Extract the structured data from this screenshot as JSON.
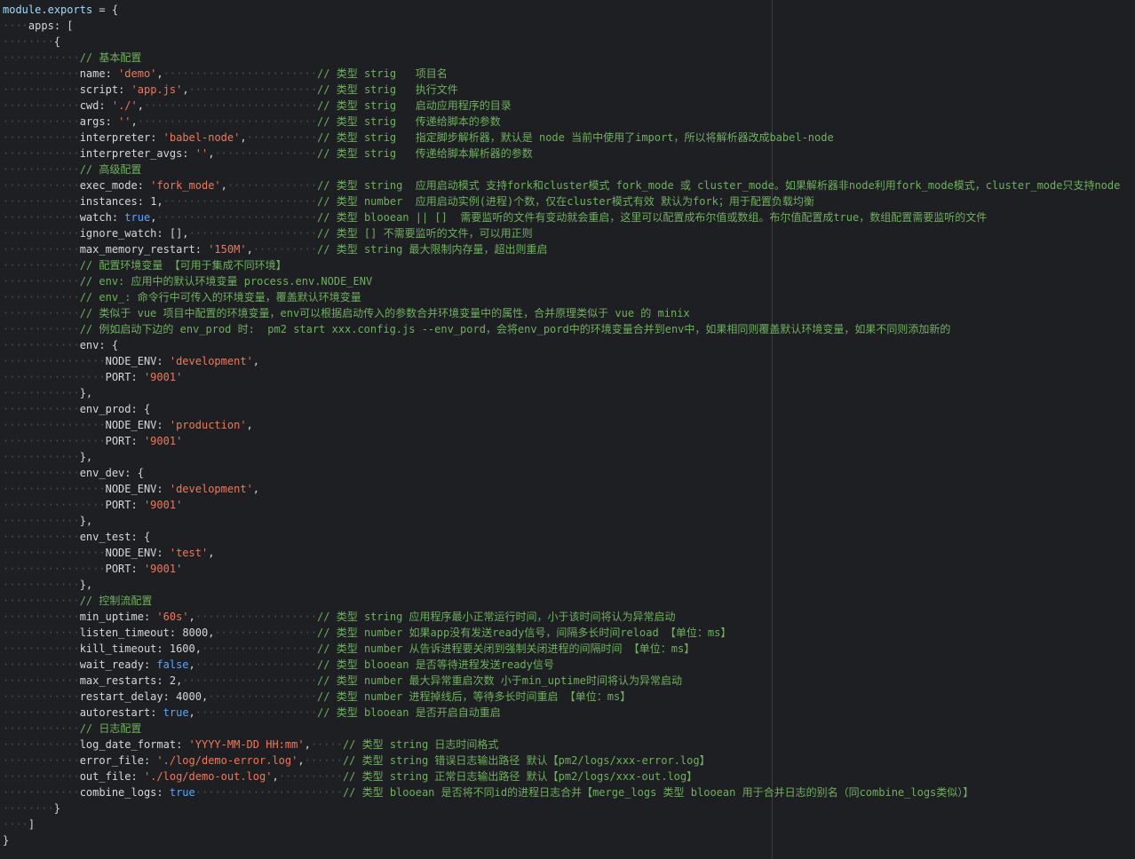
{
  "editor": {
    "language": "javascript",
    "colors": {
      "background": "#1e1f22",
      "key": "#d7d7d7",
      "string": "#f07858",
      "boolean": "#57a7ff",
      "comment": "#6fb05e",
      "whitespace_marker": "#4b4d52"
    },
    "lines": [
      {
        "indent": 0,
        "tokens": [
          {
            "t": "v",
            "x": "module"
          },
          {
            "t": "p",
            "x": "."
          },
          {
            "t": "v",
            "x": "exports"
          },
          {
            "t": "p",
            "x": " = {"
          }
        ]
      },
      {
        "indent": 1,
        "tokens": [
          {
            "t": "k",
            "x": "apps"
          },
          {
            "t": "p",
            "x": ": ["
          }
        ]
      },
      {
        "indent": 2,
        "tokens": [
          {
            "t": "p",
            "x": "{"
          }
        ]
      },
      {
        "indent": 3,
        "tokens": [
          {
            "t": "c",
            "x": "// 基本配置"
          }
        ]
      },
      {
        "indent": 3,
        "tokens": [
          {
            "t": "k",
            "x": "name"
          },
          {
            "t": "p",
            "x": ": "
          },
          {
            "t": "s",
            "x": "'demo'"
          },
          {
            "t": "p",
            "x": ","
          }
        ],
        "pad": 37,
        "comment": "// 类型 strig   项目名"
      },
      {
        "indent": 3,
        "tokens": [
          {
            "t": "k",
            "x": "script"
          },
          {
            "t": "p",
            "x": ": "
          },
          {
            "t": "s",
            "x": "'app.js'"
          },
          {
            "t": "p",
            "x": ","
          }
        ],
        "pad": 37,
        "comment": "// 类型 strig   执行文件"
      },
      {
        "indent": 3,
        "tokens": [
          {
            "t": "k",
            "x": "cwd"
          },
          {
            "t": "p",
            "x": ": "
          },
          {
            "t": "s",
            "x": "'./'"
          },
          {
            "t": "p",
            "x": ","
          }
        ],
        "pad": 37,
        "comment": "// 类型 strig   启动应用程序的目录"
      },
      {
        "indent": 3,
        "tokens": [
          {
            "t": "k",
            "x": "args"
          },
          {
            "t": "p",
            "x": ": "
          },
          {
            "t": "s",
            "x": "''"
          },
          {
            "t": "p",
            "x": ","
          }
        ],
        "pad": 37,
        "comment": "// 类型 strig   传递给脚本的参数"
      },
      {
        "indent": 3,
        "tokens": [
          {
            "t": "k",
            "x": "interpreter"
          },
          {
            "t": "p",
            "x": ": "
          },
          {
            "t": "s",
            "x": "'babel-node'"
          },
          {
            "t": "p",
            "x": ","
          }
        ],
        "pad": 37,
        "comment": "// 类型 strig   指定脚步解析器，默认是 node 当前中使用了import，所以将解析器改成babel-node"
      },
      {
        "indent": 3,
        "tokens": [
          {
            "t": "k",
            "x": "interpreter_avgs"
          },
          {
            "t": "p",
            "x": ": "
          },
          {
            "t": "s",
            "x": "''"
          },
          {
            "t": "p",
            "x": ","
          }
        ],
        "pad": 37,
        "comment": "// 类型 strig   传递给脚本解析器的参数"
      },
      {
        "indent": 3,
        "tokens": [
          {
            "t": "c",
            "x": "// 高级配置"
          }
        ]
      },
      {
        "indent": 3,
        "tokens": [
          {
            "t": "k",
            "x": "exec_mode"
          },
          {
            "t": "p",
            "x": ": "
          },
          {
            "t": "s",
            "x": "'fork_mode'"
          },
          {
            "t": "p",
            "x": ","
          }
        ],
        "pad": 37,
        "comment": "// 类型 string  应用启动模式 支持fork和cluster模式 fork_mode 或 cluster_mode。如果解析器非node利用fork_mode模式，cluster_mode只支持node"
      },
      {
        "indent": 3,
        "tokens": [
          {
            "t": "k",
            "x": "instances"
          },
          {
            "t": "p",
            "x": ": "
          },
          {
            "t": "n",
            "x": "1"
          },
          {
            "t": "p",
            "x": ","
          }
        ],
        "pad": 37,
        "comment": "// 类型 number  应用启动实例(进程)个数，仅在cluster模式有效 默认为fork；用于配置负载均衡"
      },
      {
        "indent": 3,
        "tokens": [
          {
            "t": "k",
            "x": "watch"
          },
          {
            "t": "p",
            "x": ": "
          },
          {
            "t": "b",
            "x": "true"
          },
          {
            "t": "p",
            "x": ","
          }
        ],
        "pad": 37,
        "comment": "// 类型 blooean || []  需要监听的文件有变动就会重启，这里可以配置成布尔值或数组。布尔值配置成true，数组配置需要监听的文件"
      },
      {
        "indent": 3,
        "tokens": [
          {
            "t": "k",
            "x": "ignore_watch"
          },
          {
            "t": "p",
            "x": ": [],"
          }
        ],
        "pad": 37,
        "comment": "// 类型 [] 不需要监听的文件，可以用正则"
      },
      {
        "indent": 3,
        "tokens": [
          {
            "t": "k",
            "x": "max_memory_restart"
          },
          {
            "t": "p",
            "x": ": "
          },
          {
            "t": "s",
            "x": "'150M'"
          },
          {
            "t": "p",
            "x": ","
          }
        ],
        "pad": 37,
        "comment": "// 类型 string 最大限制内存量，超出则重启"
      },
      {
        "indent": 3,
        "tokens": [
          {
            "t": "c",
            "x": "// 配置环境变量 【可用于集成不同环境】"
          }
        ]
      },
      {
        "indent": 3,
        "tokens": [
          {
            "t": "c",
            "x": "// env: 应用中的默认环境变量 process.env.NODE_ENV"
          }
        ]
      },
      {
        "indent": 3,
        "tokens": [
          {
            "t": "c",
            "x": "// env_: 命令行中可传入的环境变量，覆盖默认环境变量"
          }
        ]
      },
      {
        "indent": 3,
        "tokens": [
          {
            "t": "c",
            "x": "// 类似于 vue 项目中配置的环境变量，env可以根据启动传入的参数合并环境变量中的属性，合并原理类似于 vue 的 minix"
          }
        ]
      },
      {
        "indent": 3,
        "tokens": [
          {
            "t": "c",
            "x": "// 例如启动下边的 env_prod 时:  pm2 start xxx.config.js --env_pord，会将env_pord中的环境变量合并到env中，如果相同则覆盖默认环境变量，如果不同则添加新的"
          }
        ]
      },
      {
        "indent": 3,
        "tokens": [
          {
            "t": "k",
            "x": "env"
          },
          {
            "t": "p",
            "x": ": {"
          }
        ]
      },
      {
        "indent": 4,
        "tokens": [
          {
            "t": "k",
            "x": "NODE_ENV"
          },
          {
            "t": "p",
            "x": ": "
          },
          {
            "t": "s",
            "x": "'development'"
          },
          {
            "t": "p",
            "x": ","
          }
        ]
      },
      {
        "indent": 4,
        "tokens": [
          {
            "t": "k",
            "x": "PORT"
          },
          {
            "t": "p",
            "x": ": "
          },
          {
            "t": "s",
            "x": "'9001'"
          }
        ]
      },
      {
        "indent": 3,
        "tokens": [
          {
            "t": "p",
            "x": "},"
          }
        ]
      },
      {
        "indent": 3,
        "tokens": [
          {
            "t": "k",
            "x": "env_prod"
          },
          {
            "t": "p",
            "x": ": {"
          }
        ]
      },
      {
        "indent": 4,
        "tokens": [
          {
            "t": "k",
            "x": "NODE_ENV"
          },
          {
            "t": "p",
            "x": ": "
          },
          {
            "t": "s",
            "x": "'production'"
          },
          {
            "t": "p",
            "x": ","
          }
        ]
      },
      {
        "indent": 4,
        "tokens": [
          {
            "t": "k",
            "x": "PORT"
          },
          {
            "t": "p",
            "x": ": "
          },
          {
            "t": "s",
            "x": "'9001'"
          }
        ]
      },
      {
        "indent": 3,
        "tokens": [
          {
            "t": "p",
            "x": "},"
          }
        ]
      },
      {
        "indent": 3,
        "tokens": [
          {
            "t": "k",
            "x": "env_dev"
          },
          {
            "t": "p",
            "x": ": {"
          }
        ]
      },
      {
        "indent": 4,
        "tokens": [
          {
            "t": "k",
            "x": "NODE_ENV"
          },
          {
            "t": "p",
            "x": ": "
          },
          {
            "t": "s",
            "x": "'development'"
          },
          {
            "t": "p",
            "x": ","
          }
        ]
      },
      {
        "indent": 4,
        "tokens": [
          {
            "t": "k",
            "x": "PORT"
          },
          {
            "t": "p",
            "x": ": "
          },
          {
            "t": "s",
            "x": "'9001'"
          }
        ]
      },
      {
        "indent": 3,
        "tokens": [
          {
            "t": "p",
            "x": "},"
          }
        ]
      },
      {
        "indent": 3,
        "tokens": [
          {
            "t": "k",
            "x": "env_test"
          },
          {
            "t": "p",
            "x": ": {"
          }
        ]
      },
      {
        "indent": 4,
        "tokens": [
          {
            "t": "k",
            "x": "NODE_ENV"
          },
          {
            "t": "p",
            "x": ": "
          },
          {
            "t": "s",
            "x": "'test'"
          },
          {
            "t": "p",
            "x": ","
          }
        ]
      },
      {
        "indent": 4,
        "tokens": [
          {
            "t": "k",
            "x": "PORT"
          },
          {
            "t": "p",
            "x": ": "
          },
          {
            "t": "s",
            "x": "'9001'"
          }
        ]
      },
      {
        "indent": 3,
        "tokens": [
          {
            "t": "p",
            "x": "},"
          }
        ]
      },
      {
        "indent": 3,
        "tokens": [
          {
            "t": "c",
            "x": "// 控制流配置"
          }
        ]
      },
      {
        "indent": 3,
        "tokens": [
          {
            "t": "k",
            "x": "min_uptime"
          },
          {
            "t": "p",
            "x": ": "
          },
          {
            "t": "s",
            "x": "'60s'"
          },
          {
            "t": "p",
            "x": ","
          }
        ],
        "pad": 37,
        "comment": "// 类型 string 应用程序最小正常运行时间，小于该时间将认为异常启动"
      },
      {
        "indent": 3,
        "tokens": [
          {
            "t": "k",
            "x": "listen_timeout"
          },
          {
            "t": "p",
            "x": ": "
          },
          {
            "t": "n",
            "x": "8000"
          },
          {
            "t": "p",
            "x": ","
          }
        ],
        "pad": 37,
        "comment": "// 类型 number 如果app没有发送ready信号，间隔多长时间reload 【单位：ms】"
      },
      {
        "indent": 3,
        "tokens": [
          {
            "t": "k",
            "x": "kill_timeout"
          },
          {
            "t": "p",
            "x": ": "
          },
          {
            "t": "n",
            "x": "1600"
          },
          {
            "t": "p",
            "x": ","
          }
        ],
        "pad": 37,
        "comment": "// 类型 number 从告诉进程要关闭到强制关闭进程的间隔时间 【单位：ms】"
      },
      {
        "indent": 3,
        "tokens": [
          {
            "t": "k",
            "x": "wait_ready"
          },
          {
            "t": "p",
            "x": ": "
          },
          {
            "t": "b",
            "x": "false"
          },
          {
            "t": "p",
            "x": ","
          }
        ],
        "pad": 37,
        "comment": "// 类型 blooean 是否等待进程发送ready信号"
      },
      {
        "indent": 3,
        "tokens": [
          {
            "t": "k",
            "x": "max_restarts"
          },
          {
            "t": "p",
            "x": ": "
          },
          {
            "t": "n",
            "x": "2"
          },
          {
            "t": "p",
            "x": ","
          }
        ],
        "pad": 37,
        "comment": "// 类型 number 最大异常重启次数 小于min_uptime时间将认为异常启动"
      },
      {
        "indent": 3,
        "tokens": [
          {
            "t": "k",
            "x": "restart_delay"
          },
          {
            "t": "p",
            "x": ": "
          },
          {
            "t": "n",
            "x": "4000"
          },
          {
            "t": "p",
            "x": ","
          }
        ],
        "pad": 37,
        "comment": "// 类型 number 进程掉线后，等待多长时间重启 【单位：ms】"
      },
      {
        "indent": 3,
        "tokens": [
          {
            "t": "k",
            "x": "autorestart"
          },
          {
            "t": "p",
            "x": ": "
          },
          {
            "t": "b",
            "x": "true"
          },
          {
            "t": "p",
            "x": ","
          }
        ],
        "pad": 37,
        "comment": "// 类型 blooean 是否开启自动重启"
      },
      {
        "indent": 3,
        "tokens": [
          {
            "t": "c",
            "x": "// 日志配置"
          }
        ]
      },
      {
        "indent": 3,
        "tokens": [
          {
            "t": "k",
            "x": "log_date_format"
          },
          {
            "t": "p",
            "x": ": "
          },
          {
            "t": "s",
            "x": "'YYYY-MM-DD HH:mm'"
          },
          {
            "t": "p",
            "x": ","
          }
        ],
        "pad": 41,
        "comment": "// 类型 string 日志时间格式"
      },
      {
        "indent": 3,
        "tokens": [
          {
            "t": "k",
            "x": "error_file"
          },
          {
            "t": "p",
            "x": ": "
          },
          {
            "t": "s",
            "x": "'./log/demo-error.log'"
          },
          {
            "t": "p",
            "x": ","
          }
        ],
        "pad": 41,
        "comment": "// 类型 string 错误日志输出路径 默认【pm2/logs/xxx-error.log】"
      },
      {
        "indent": 3,
        "tokens": [
          {
            "t": "k",
            "x": "out_file"
          },
          {
            "t": "p",
            "x": ": "
          },
          {
            "t": "s",
            "x": "'./log/demo-out.log'"
          },
          {
            "t": "p",
            "x": ","
          }
        ],
        "pad": 41,
        "comment": "// 类型 string 正常日志输出路径 默认【pm2/logs/xxx-out.log】"
      },
      {
        "indent": 3,
        "tokens": [
          {
            "t": "k",
            "x": "combine_logs"
          },
          {
            "t": "p",
            "x": ": "
          },
          {
            "t": "b",
            "x": "true"
          }
        ],
        "pad": 41,
        "comment": "// 类型 blooean 是否将不同id的进程日志合并【merge_logs 类型 blooean 用于合并日志的别名（同combine_logs类似）】"
      },
      {
        "indent": 2,
        "tokens": [
          {
            "t": "p",
            "x": "}"
          }
        ]
      },
      {
        "indent": 1,
        "tokens": [
          {
            "t": "p",
            "x": "]"
          }
        ]
      },
      {
        "indent": 0,
        "tokens": [
          {
            "t": "p",
            "x": "}"
          }
        ]
      }
    ]
  }
}
